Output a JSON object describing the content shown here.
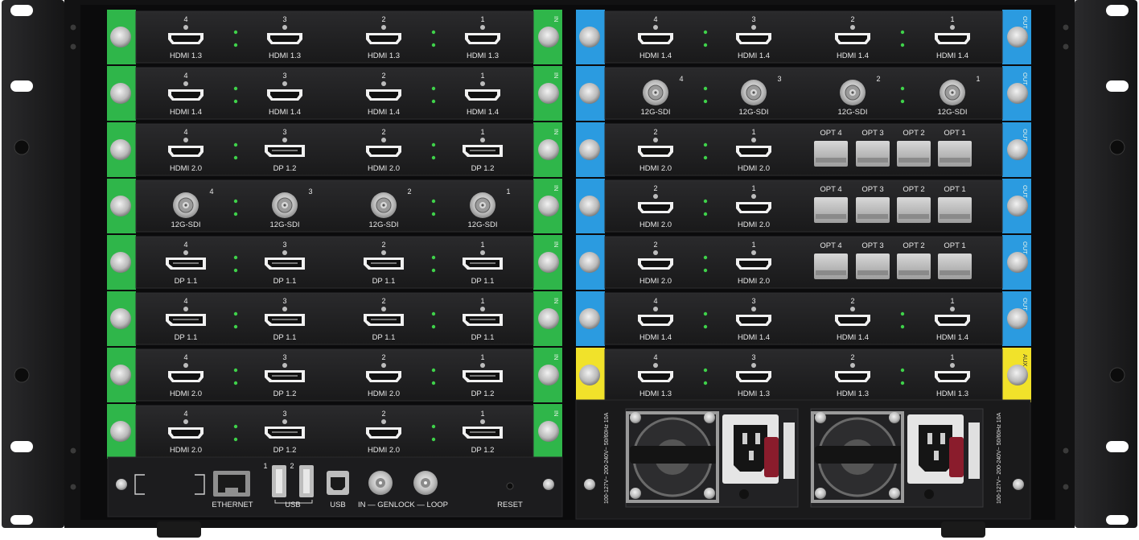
{
  "colors": {
    "in_tab": "#2fb64a",
    "out_tab": "#2b9be0",
    "aux_tab": "#f1e22a",
    "panel": "#1d1d1f",
    "led": "#3fd24a"
  },
  "input_cards": [
    {
      "tab": "IN",
      "ports": [
        {
          "n": "4",
          "type": "hdmi",
          "label": "HDMI 1.3"
        },
        {
          "n": "3",
          "type": "hdmi",
          "label": "HDMI 1.3"
        },
        {
          "n": "2",
          "type": "hdmi",
          "label": "HDMI 1.3"
        },
        {
          "n": "1",
          "type": "hdmi",
          "label": "HDMI 1.3"
        }
      ]
    },
    {
      "tab": "IN",
      "ports": [
        {
          "n": "4",
          "type": "hdmi",
          "label": "HDMI 1.4"
        },
        {
          "n": "3",
          "type": "hdmi",
          "label": "HDMI 1.4"
        },
        {
          "n": "2",
          "type": "hdmi",
          "label": "HDMI 1.4"
        },
        {
          "n": "1",
          "type": "hdmi",
          "label": "HDMI 1.4"
        }
      ]
    },
    {
      "tab": "IN",
      "ports": [
        {
          "n": "4",
          "type": "hdmi",
          "label": "HDMI 2.0"
        },
        {
          "n": "3",
          "type": "dp",
          "label": "DP 1.2"
        },
        {
          "n": "2",
          "type": "hdmi",
          "label": "HDMI 2.0"
        },
        {
          "n": "1",
          "type": "dp",
          "label": "DP 1.2"
        }
      ]
    },
    {
      "tab": "IN",
      "ports": [
        {
          "n": "4",
          "type": "bnc",
          "label": "12G-SDI"
        },
        {
          "n": "3",
          "type": "bnc",
          "label": "12G-SDI"
        },
        {
          "n": "2",
          "type": "bnc",
          "label": "12G-SDI"
        },
        {
          "n": "1",
          "type": "bnc",
          "label": "12G-SDI"
        }
      ]
    },
    {
      "tab": "IN",
      "ports": [
        {
          "n": "4",
          "type": "dp",
          "label": "DP 1.1"
        },
        {
          "n": "3",
          "type": "dp",
          "label": "DP 1.1"
        },
        {
          "n": "2",
          "type": "dp",
          "label": "DP 1.1"
        },
        {
          "n": "1",
          "type": "dp",
          "label": "DP 1.1"
        }
      ]
    },
    {
      "tab": "IN",
      "ports": [
        {
          "n": "4",
          "type": "dp",
          "label": "DP 1.1"
        },
        {
          "n": "3",
          "type": "dp",
          "label": "DP 1.1"
        },
        {
          "n": "2",
          "type": "dp",
          "label": "DP 1.1"
        },
        {
          "n": "1",
          "type": "dp",
          "label": "DP 1.1"
        }
      ]
    },
    {
      "tab": "IN",
      "ports": [
        {
          "n": "4",
          "type": "hdmi",
          "label": "HDMI 2.0"
        },
        {
          "n": "3",
          "type": "dp",
          "label": "DP 1.2"
        },
        {
          "n": "2",
          "type": "hdmi",
          "label": "HDMI 2.0"
        },
        {
          "n": "1",
          "type": "dp",
          "label": "DP 1.2"
        }
      ]
    },
    {
      "tab": "IN",
      "ports": [
        {
          "n": "4",
          "type": "hdmi",
          "label": "HDMI 2.0"
        },
        {
          "n": "3",
          "type": "dp",
          "label": "DP 1.2"
        },
        {
          "n": "2",
          "type": "hdmi",
          "label": "HDMI 2.0"
        },
        {
          "n": "1",
          "type": "dp",
          "label": "DP 1.2"
        }
      ]
    }
  ],
  "output_cards": [
    {
      "tab": "OUT",
      "kind": "ports",
      "ports": [
        {
          "n": "4",
          "type": "hdmi",
          "label": "HDMI 1.4"
        },
        {
          "n": "3",
          "type": "hdmi",
          "label": "HDMI 1.4"
        },
        {
          "n": "2",
          "type": "hdmi",
          "label": "HDMI 1.4"
        },
        {
          "n": "1",
          "type": "hdmi",
          "label": "HDMI 1.4"
        }
      ]
    },
    {
      "tab": "OUT",
      "kind": "ports",
      "ports": [
        {
          "n": "4",
          "type": "bnc",
          "label": "12G-SDI"
        },
        {
          "n": "3",
          "type": "bnc",
          "label": "12G-SDI"
        },
        {
          "n": "2",
          "type": "bnc",
          "label": "12G-SDI"
        },
        {
          "n": "1",
          "type": "bnc",
          "label": "12G-SDI"
        }
      ]
    },
    {
      "tab": "OUT",
      "kind": "opt",
      "ports": [
        {
          "n": "2",
          "type": "hdmi",
          "label": "HDMI 2.0"
        },
        {
          "n": "1",
          "type": "hdmi",
          "label": "HDMI 2.0"
        }
      ],
      "opts": [
        "OPT 4",
        "OPT 3",
        "OPT 2",
        "OPT 1"
      ]
    },
    {
      "tab": "OUT",
      "kind": "opt",
      "ports": [
        {
          "n": "2",
          "type": "hdmi",
          "label": "HDMI 2.0"
        },
        {
          "n": "1",
          "type": "hdmi",
          "label": "HDMI 2.0"
        }
      ],
      "opts": [
        "OPT 4",
        "OPT 3",
        "OPT 2",
        "OPT 1"
      ]
    },
    {
      "tab": "OUT",
      "kind": "opt",
      "ports": [
        {
          "n": "2",
          "type": "hdmi",
          "label": "HDMI 2.0"
        },
        {
          "n": "1",
          "type": "hdmi",
          "label": "HDMI 2.0"
        }
      ],
      "opts": [
        "OPT 4",
        "OPT 3",
        "OPT 2",
        "OPT 1"
      ]
    },
    {
      "tab": "OUT",
      "kind": "ports",
      "ports": [
        {
          "n": "4",
          "type": "hdmi",
          "label": "HDMI 1.4"
        },
        {
          "n": "3",
          "type": "hdmi",
          "label": "HDMI 1.4"
        },
        {
          "n": "2",
          "type": "hdmi",
          "label": "HDMI 1.4"
        },
        {
          "n": "1",
          "type": "hdmi",
          "label": "HDMI 1.4"
        }
      ]
    },
    {
      "tab": "AUX",
      "kind": "ports",
      "ports": [
        {
          "n": "4",
          "type": "hdmi",
          "label": "HDMI 1.3"
        },
        {
          "n": "3",
          "type": "hdmi",
          "label": "HDMI 1.3"
        },
        {
          "n": "2",
          "type": "hdmi",
          "label": "HDMI 1.3"
        },
        {
          "n": "1",
          "type": "hdmi",
          "label": "HDMI 1.3"
        }
      ]
    }
  ],
  "control": {
    "ethernet": "ETHERNET",
    "usb_front": "USB",
    "usb_b": "USB",
    "usb_num_1": "1",
    "usb_num_2": "2",
    "genlock": "IN — GENLOCK — LOOP",
    "reset": "RESET"
  },
  "psu": {
    "rating": "100-127V~ 200-240V~ 50/60Hz 10A"
  }
}
